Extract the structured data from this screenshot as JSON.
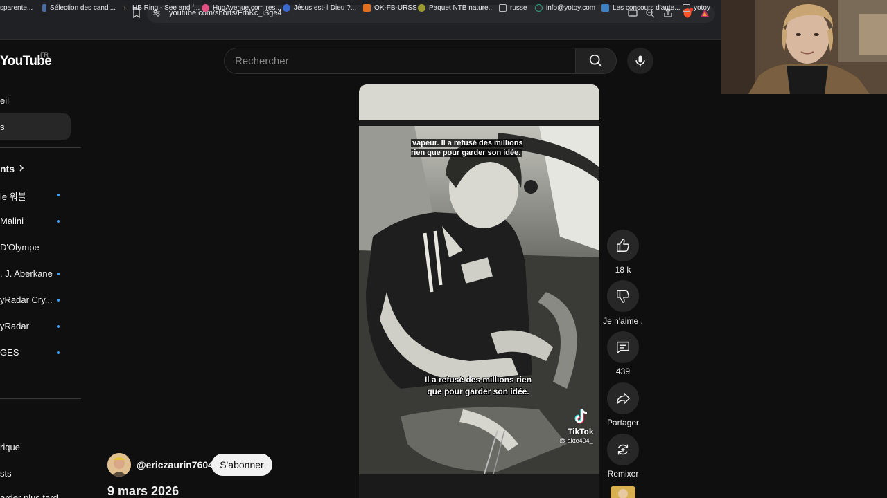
{
  "browser": {
    "url": "youtube.com/shorts/FrhKc_iSge4",
    "bookmarks": [
      {
        "label": "sparente...",
        "color": "#888"
      },
      {
        "label": "Sélection des candi...",
        "color": "#4a6aa0"
      },
      {
        "label": "HB Ring - See and f...",
        "color": "#333"
      },
      {
        "label": "HugAvenue.com res...",
        "color": "#e05080"
      },
      {
        "label": "Jésus est-il Dieu ?...",
        "color": "#3a6ad0"
      },
      {
        "label": "OK-FB-URSS",
        "color": "#e07020"
      },
      {
        "label": "Paquet NTB nature...",
        "color": "#9a9a30"
      },
      {
        "label": "russe",
        "color": "#aaa"
      },
      {
        "label": "info@yotoy.com",
        "color": "#30a080"
      },
      {
        "label": "Les concours d'aute...",
        "color": "#4080c0"
      },
      {
        "label": "yotoy",
        "color": "#aaa"
      }
    ]
  },
  "header": {
    "logo": "YouTube",
    "region": "FR",
    "search_placeholder": "Rechercher"
  },
  "sidebar": {
    "items": [
      {
        "label": "eil"
      },
      {
        "label": "s"
      },
      {
        "label": "nts"
      },
      {
        "label": "le 워블"
      },
      {
        "label": "Malini"
      },
      {
        "label": "D'Olympe"
      },
      {
        "label": ". J. Aberkane"
      },
      {
        "label": "yRadar Cry..."
      },
      {
        "label": "yRadar"
      },
      {
        "label": "GES"
      },
      {
        "label": "rique"
      },
      {
        "label": "sts"
      },
      {
        "label": "arder plus tard"
      }
    ]
  },
  "video": {
    "caption_top": "vapeur. Il a refusé des millions rien que pour garder son idée.",
    "caption_mid_1": "Il a refusé des millions rien",
    "caption_mid_2": "que pour garder son idée.",
    "watermark": "TikTok",
    "watermark_handle": "@ akte404_"
  },
  "actions": {
    "like_count": "18 k",
    "dislike_label": "Je n'aime .",
    "comments_count": "439",
    "share_label": "Partager",
    "remix_label": "Remixer"
  },
  "channel": {
    "handle": "@ericzaurin7604",
    "subscribe_label": "S'abonner",
    "date": "9 mars 2026"
  }
}
